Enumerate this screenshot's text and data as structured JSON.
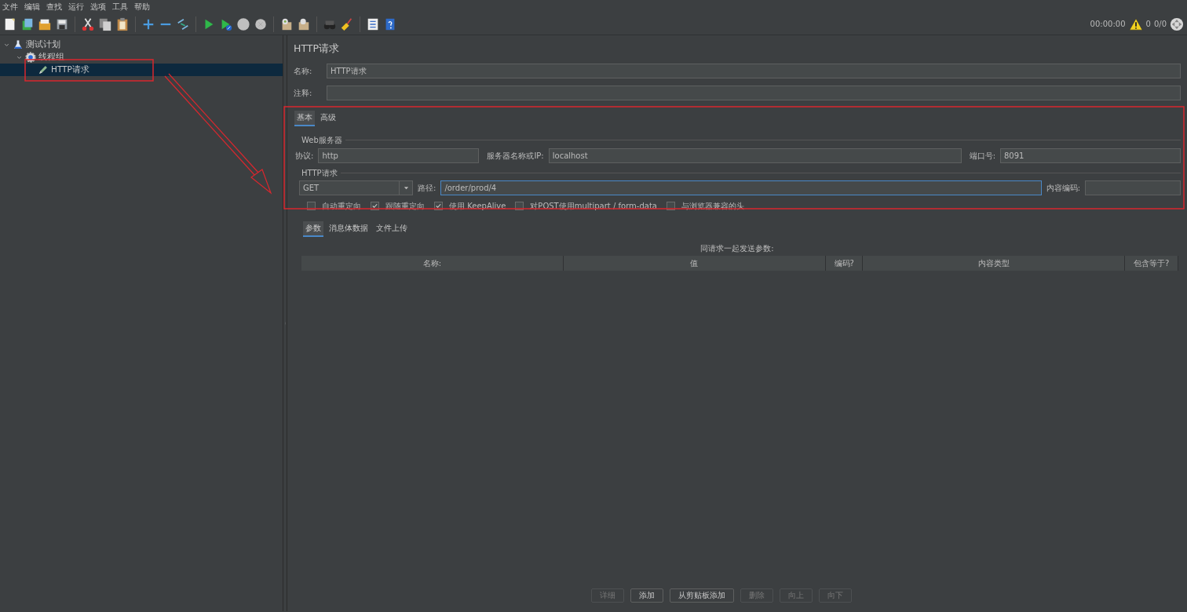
{
  "menu": [
    "文件",
    "编辑",
    "查找",
    "运行",
    "选项",
    "工具",
    "帮助"
  ],
  "status": {
    "timer": "00:00:00",
    "warnings": "0",
    "threads": "0/0"
  },
  "tree": [
    {
      "label": "测试计划",
      "kind": "plan",
      "expanded": true,
      "selected": false,
      "children": [
        {
          "label": "线程组",
          "kind": "threadgroup",
          "expanded": true,
          "selected": false,
          "children": [
            {
              "label": "HTTP请求",
              "kind": "sampler",
              "selected": true
            }
          ]
        }
      ]
    }
  ],
  "panel": {
    "title": "HTTP请求",
    "name_label": "名称:",
    "name_value": "HTTP请求",
    "comment_label": "注释:"
  },
  "tabs": [
    {
      "label": "基本",
      "selected": true
    },
    {
      "label": "高级",
      "selected": false
    }
  ],
  "web_server": {
    "legend": "Web服务器",
    "fields": [
      {
        "label": "协议:",
        "value": "http"
      },
      {
        "label": "服务器名称或IP:",
        "value": "localhost"
      },
      {
        "label": "端口号:",
        "value": "8091"
      }
    ]
  },
  "http_request": {
    "legend": "HTTP请求",
    "method": "GET",
    "path_label": "路径:",
    "path": "/order/prod/4",
    "encoding_label": "内容编码:",
    "options": [
      {
        "label": "自动重定向",
        "checked": false
      },
      {
        "label": "跟随重定向",
        "checked": true
      },
      {
        "label": "使用 KeepAlive",
        "checked": true
      },
      {
        "label": "对POST使用multipart / form-data",
        "checked": false
      },
      {
        "label": "与浏览器兼容的头",
        "checked": false
      }
    ]
  },
  "param_tabs": [
    {
      "label": "参数",
      "selected": true
    },
    {
      "label": "消息体数据",
      "selected": false
    },
    {
      "label": "文件上传",
      "selected": false
    }
  ],
  "table": {
    "caption": "同请求一起发送参数:",
    "columns": [
      "名称:",
      "值",
      "编码?",
      "内容类型",
      "包含等于?"
    ]
  },
  "buttons": [
    {
      "label": "详细",
      "disabled": true
    },
    {
      "label": "添加",
      "disabled": false
    },
    {
      "label": "从剪贴板添加",
      "disabled": false
    },
    {
      "label": "删除",
      "disabled": true
    },
    {
      "label": "向上",
      "disabled": true
    },
    {
      "label": "向下",
      "disabled": true
    }
  ]
}
